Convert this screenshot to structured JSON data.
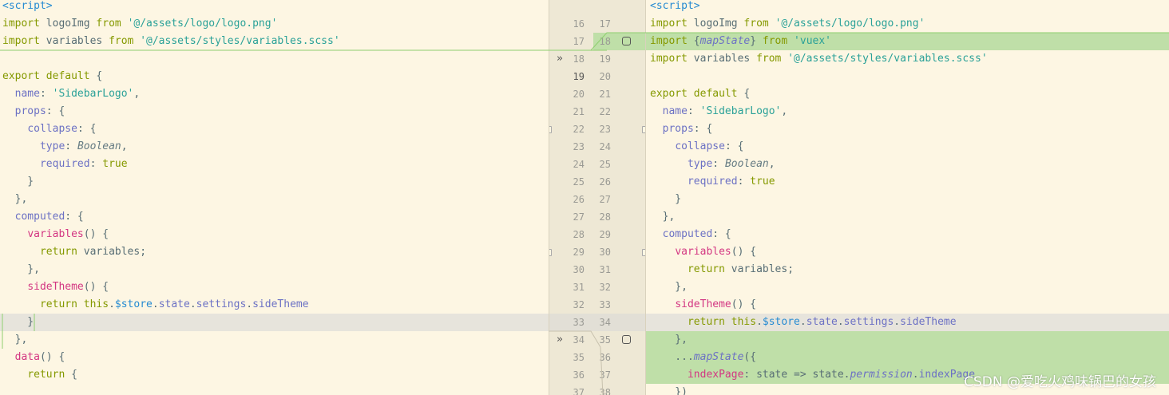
{
  "diff": {
    "left_lines": [
      {
        "num": "",
        "tokens": [
          [
            "tk-tag",
            "<script>"
          ]
        ]
      },
      {
        "num": "16",
        "tokens": [
          [
            "tk-kw",
            "import"
          ],
          [
            "tk-pl",
            " logoImg "
          ],
          [
            "tk-kw",
            "from"
          ],
          [
            "tk-pl",
            " "
          ],
          [
            "tk-str",
            "'@/assets/logo/logo.png'"
          ]
        ]
      },
      {
        "num": "17",
        "tokens": [
          [
            "tk-kw",
            "import"
          ],
          [
            "tk-pl",
            " variables "
          ],
          [
            "tk-kw",
            "from"
          ],
          [
            "tk-pl",
            " "
          ],
          [
            "tk-str",
            "'@/assets/styles/variables.scss'"
          ]
        ]
      },
      {
        "num": "18",
        "tokens": []
      },
      {
        "num": "19",
        "tokens": [
          [
            "tk-kw",
            "export default"
          ],
          [
            "tk-pl",
            " {"
          ]
        ]
      },
      {
        "num": "20",
        "tokens": [
          [
            "tk-pl",
            "  "
          ],
          [
            "tk-prop",
            "name"
          ],
          [
            "tk-pl",
            ": "
          ],
          [
            "tk-str",
            "'SidebarLogo'"
          ],
          [
            "tk-pl",
            ","
          ]
        ]
      },
      {
        "num": "21",
        "tokens": [
          [
            "tk-pl",
            "  "
          ],
          [
            "tk-prop",
            "props"
          ],
          [
            "tk-pl",
            ": {"
          ]
        ]
      },
      {
        "num": "22",
        "tokens": [
          [
            "tk-pl",
            "    "
          ],
          [
            "tk-prop",
            "collapse"
          ],
          [
            "tk-pl",
            ": {"
          ]
        ]
      },
      {
        "num": "23",
        "tokens": [
          [
            "tk-pl",
            "      "
          ],
          [
            "tk-prop",
            "type"
          ],
          [
            "tk-pl",
            ": "
          ],
          [
            "tk-type",
            "Boolean"
          ],
          [
            "tk-pl",
            ","
          ]
        ]
      },
      {
        "num": "24",
        "tokens": [
          [
            "tk-pl",
            "      "
          ],
          [
            "tk-prop",
            "required"
          ],
          [
            "tk-pl",
            ": "
          ],
          [
            "tk-kw",
            "true"
          ]
        ]
      },
      {
        "num": "25",
        "tokens": [
          [
            "tk-pl",
            "    }"
          ]
        ]
      },
      {
        "num": "26",
        "tokens": [
          [
            "tk-pl",
            "  },"
          ]
        ]
      },
      {
        "num": "27",
        "tokens": [
          [
            "tk-pl",
            "  "
          ],
          [
            "tk-prop",
            "computed"
          ],
          [
            "tk-pl",
            ": {"
          ]
        ]
      },
      {
        "num": "28",
        "tokens": [
          [
            "tk-pl",
            "    "
          ],
          [
            "tk-fn",
            "variables"
          ],
          [
            "tk-pl",
            "() {"
          ]
        ]
      },
      {
        "num": "29",
        "tokens": [
          [
            "tk-pl",
            "      "
          ],
          [
            "tk-kw",
            "return"
          ],
          [
            "tk-pl",
            " variables;"
          ]
        ]
      },
      {
        "num": "30",
        "tokens": [
          [
            "tk-pl",
            "    },"
          ]
        ]
      },
      {
        "num": "31",
        "tokens": [
          [
            "tk-pl",
            "    "
          ],
          [
            "tk-fn",
            "sideTheme"
          ],
          [
            "tk-pl",
            "() {"
          ]
        ]
      },
      {
        "num": "32",
        "tokens": [
          [
            "tk-pl",
            "      "
          ],
          [
            "tk-kw",
            "return this"
          ],
          [
            "tk-pl",
            "."
          ],
          [
            "tk-var",
            "$store"
          ],
          [
            "tk-pl",
            "."
          ],
          [
            "tk-prop",
            "state"
          ],
          [
            "tk-pl",
            "."
          ],
          [
            "tk-prop",
            "settings"
          ],
          [
            "tk-pl",
            "."
          ],
          [
            "tk-prop",
            "sideTheme"
          ]
        ]
      },
      {
        "num": "33",
        "tokens": [
          [
            "tk-pl",
            "    }"
          ]
        ]
      },
      {
        "num": "34",
        "tokens": [
          [
            "tk-pl",
            "  },"
          ]
        ]
      },
      {
        "num": "35",
        "tokens": [
          [
            "tk-pl",
            "  "
          ],
          [
            "tk-fn",
            "data"
          ],
          [
            "tk-pl",
            "() {"
          ]
        ]
      },
      {
        "num": "36",
        "tokens": [
          [
            "tk-pl",
            "    "
          ],
          [
            "tk-kw",
            "return"
          ],
          [
            "tk-pl",
            " {"
          ]
        ]
      },
      {
        "num": "37",
        "tokens": []
      }
    ],
    "right_lines": [
      {
        "num": "",
        "tokens": [
          [
            "tk-tag",
            "<script>"
          ]
        ]
      },
      {
        "num": "17",
        "tokens": [
          [
            "tk-kw",
            "import"
          ],
          [
            "tk-pl",
            " logoImg "
          ],
          [
            "tk-kw",
            "from"
          ],
          [
            "tk-pl",
            " "
          ],
          [
            "tk-str",
            "'@/assets/logo/logo.png'"
          ]
        ]
      },
      {
        "num": "18",
        "tokens": [
          [
            "tk-kw",
            "import"
          ],
          [
            "tk-pl",
            " {"
          ],
          [
            "tk-it",
            "mapState"
          ],
          [
            "tk-pl",
            "} "
          ],
          [
            "tk-kw",
            "from"
          ],
          [
            "tk-pl",
            " "
          ],
          [
            "tk-str",
            "'vuex'"
          ]
        ]
      },
      {
        "num": "19",
        "tokens": [
          [
            "tk-kw",
            "import"
          ],
          [
            "tk-pl",
            " variables "
          ],
          [
            "tk-kw",
            "from"
          ],
          [
            "tk-pl",
            " "
          ],
          [
            "tk-str",
            "'@/assets/styles/variables.scss'"
          ]
        ]
      },
      {
        "num": "20",
        "tokens": []
      },
      {
        "num": "21",
        "tokens": [
          [
            "tk-kw",
            "export default"
          ],
          [
            "tk-pl",
            " {"
          ]
        ]
      },
      {
        "num": "22",
        "tokens": [
          [
            "tk-pl",
            "  "
          ],
          [
            "tk-prop",
            "name"
          ],
          [
            "tk-pl",
            ": "
          ],
          [
            "tk-str",
            "'SidebarLogo'"
          ],
          [
            "tk-pl",
            ","
          ]
        ]
      },
      {
        "num": "23",
        "tokens": [
          [
            "tk-pl",
            "  "
          ],
          [
            "tk-prop",
            "props"
          ],
          [
            "tk-pl",
            ": {"
          ]
        ]
      },
      {
        "num": "24",
        "tokens": [
          [
            "tk-pl",
            "    "
          ],
          [
            "tk-prop",
            "collapse"
          ],
          [
            "tk-pl",
            ": {"
          ]
        ]
      },
      {
        "num": "25",
        "tokens": [
          [
            "tk-pl",
            "      "
          ],
          [
            "tk-prop",
            "type"
          ],
          [
            "tk-pl",
            ": "
          ],
          [
            "tk-type",
            "Boolean"
          ],
          [
            "tk-pl",
            ","
          ]
        ]
      },
      {
        "num": "26",
        "tokens": [
          [
            "tk-pl",
            "      "
          ],
          [
            "tk-prop",
            "required"
          ],
          [
            "tk-pl",
            ": "
          ],
          [
            "tk-kw",
            "true"
          ]
        ]
      },
      {
        "num": "27",
        "tokens": [
          [
            "tk-pl",
            "    }"
          ]
        ]
      },
      {
        "num": "28",
        "tokens": [
          [
            "tk-pl",
            "  },"
          ]
        ]
      },
      {
        "num": "29",
        "tokens": [
          [
            "tk-pl",
            "  "
          ],
          [
            "tk-prop",
            "computed"
          ],
          [
            "tk-pl",
            ": {"
          ]
        ]
      },
      {
        "num": "30",
        "tokens": [
          [
            "tk-pl",
            "    "
          ],
          [
            "tk-fn",
            "variables"
          ],
          [
            "tk-pl",
            "() {"
          ]
        ]
      },
      {
        "num": "31",
        "tokens": [
          [
            "tk-pl",
            "      "
          ],
          [
            "tk-kw",
            "return"
          ],
          [
            "tk-pl",
            " variables;"
          ]
        ]
      },
      {
        "num": "32",
        "tokens": [
          [
            "tk-pl",
            "    },"
          ]
        ]
      },
      {
        "num": "33",
        "tokens": [
          [
            "tk-pl",
            "    "
          ],
          [
            "tk-fn",
            "sideTheme"
          ],
          [
            "tk-pl",
            "() {"
          ]
        ]
      },
      {
        "num": "34",
        "tokens": [
          [
            "tk-pl",
            "      "
          ],
          [
            "tk-kw",
            "return this"
          ],
          [
            "tk-pl",
            "."
          ],
          [
            "tk-var",
            "$store"
          ],
          [
            "tk-pl",
            "."
          ],
          [
            "tk-prop",
            "state"
          ],
          [
            "tk-pl",
            "."
          ],
          [
            "tk-prop",
            "settings"
          ],
          [
            "tk-pl",
            "."
          ],
          [
            "tk-prop",
            "sideTheme"
          ]
        ]
      },
      {
        "num": "35",
        "tokens": [
          [
            "tk-pl",
            "    },"
          ]
        ]
      },
      {
        "num": "36",
        "tokens": [
          [
            "tk-pl",
            "    ..."
          ],
          [
            "tk-it",
            "mapState"
          ],
          [
            "tk-pl",
            "({"
          ]
        ]
      },
      {
        "num": "37",
        "tokens": [
          [
            "tk-pl",
            "      "
          ],
          [
            "tk-fn",
            "indexPage"
          ],
          [
            "tk-pl",
            ": state => state."
          ],
          [
            "tk-it",
            "permission"
          ],
          [
            "tk-pl",
            "."
          ],
          [
            "tk-prop",
            "indexPage"
          ]
        ]
      },
      {
        "num": "38",
        "tokens": [
          [
            "tk-pl",
            "    })"
          ]
        ]
      }
    ],
    "top_edge_nums": {
      "left": "15",
      "right": "16"
    },
    "left_highlight_rows": {
      "grey": [
        18
      ]
    },
    "right_highlight_rows": {
      "green": [
        2,
        19,
        20,
        21
      ],
      "grey": [
        18
      ]
    },
    "change_markers": {
      "chevron_rows": [
        3,
        19
      ],
      "checkbox_rows": [
        2,
        19
      ]
    },
    "current_line": "19"
  },
  "watermark": "CSDN @爱吃火鸡味锅巴的女孩",
  "colors": {
    "bg": "#fdf6e3",
    "gutter": "#eee8d5",
    "added": "#bfdfa8",
    "changed": "#e7e4dc",
    "connector": "#8fcf6f"
  }
}
